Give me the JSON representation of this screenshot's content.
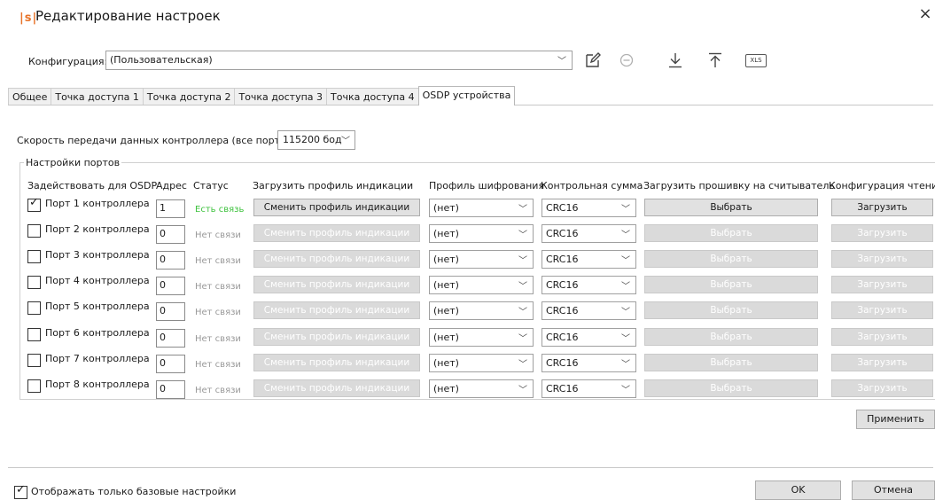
{
  "window": {
    "logo": "|s|",
    "title": "Редактирование настроек",
    "close": "×"
  },
  "config": {
    "label": "Конфигурация:",
    "value": "(Пользовательская)",
    "toolbar": {
      "edit_icon": "edit-icon",
      "remove_icon": "minus-circle-icon",
      "download_icon": "download-icon",
      "upload_icon": "upload-icon",
      "xls_label": "XLS"
    }
  },
  "tabs": [
    {
      "label": "Общее",
      "active": false
    },
    {
      "label": "Точка доступа 1",
      "active": false
    },
    {
      "label": "Точка доступа 2",
      "active": false
    },
    {
      "label": "Точка доступа 3",
      "active": false
    },
    {
      "label": "Точка доступа 4",
      "active": false
    },
    {
      "label": "OSDP устройства",
      "active": true
    }
  ],
  "speed": {
    "label": "Скорость передачи данных контроллера (все порты):",
    "value": "115200 бод"
  },
  "ports_group": {
    "legend": "Настройки портов",
    "headers": {
      "enable": "Задействовать для OSDP",
      "address": "Адрес",
      "status": "Статус",
      "indication": "Загрузить профиль индикации",
      "encryption": "Профиль шифрования",
      "checksum": "Контрольная сумма",
      "firmware": "Загрузить прошивку на считыватель",
      "read_config": "Конфигурация чтения"
    },
    "rows": [
      {
        "checked": true,
        "port": "Порт 1 контроллера",
        "address": "1",
        "status": "Есть связь",
        "connected": true,
        "indication": "Сменить профиль индикации",
        "encryption": "(нет)",
        "checksum": "CRC16",
        "firmware": "Выбрать",
        "read_config": "Загрузить"
      },
      {
        "checked": false,
        "port": "Порт 2 контроллера",
        "address": "0",
        "status": "Нет связи",
        "connected": false,
        "indication": "Сменить профиль индикации",
        "encryption": "(нет)",
        "checksum": "CRC16",
        "firmware": "Выбрать",
        "read_config": "Загрузить"
      },
      {
        "checked": false,
        "port": "Порт 3 контроллера",
        "address": "0",
        "status": "Нет связи",
        "connected": false,
        "indication": "Сменить профиль индикации",
        "encryption": "(нет)",
        "checksum": "CRC16",
        "firmware": "Выбрать",
        "read_config": "Загрузить"
      },
      {
        "checked": false,
        "port": "Порт 4 контроллера",
        "address": "0",
        "status": "Нет связи",
        "connected": false,
        "indication": "Сменить профиль индикации",
        "encryption": "(нет)",
        "checksum": "CRC16",
        "firmware": "Выбрать",
        "read_config": "Загрузить"
      },
      {
        "checked": false,
        "port": "Порт 5 контроллера",
        "address": "0",
        "status": "Нет связи",
        "connected": false,
        "indication": "Сменить профиль индикации",
        "encryption": "(нет)",
        "checksum": "CRC16",
        "firmware": "Выбрать",
        "read_config": "Загрузить"
      },
      {
        "checked": false,
        "port": "Порт 6 контроллера",
        "address": "0",
        "status": "Нет связи",
        "connected": false,
        "indication": "Сменить профиль индикации",
        "encryption": "(нет)",
        "checksum": "CRC16",
        "firmware": "Выбрать",
        "read_config": "Загрузить"
      },
      {
        "checked": false,
        "port": "Порт 7 контроллера",
        "address": "0",
        "status": "Нет связи",
        "connected": false,
        "indication": "Сменить профиль индикации",
        "encryption": "(нет)",
        "checksum": "CRC16",
        "firmware": "Выбрать",
        "read_config": "Загрузить"
      },
      {
        "checked": false,
        "port": "Порт 8 контроллера",
        "address": "0",
        "status": "Нет связи",
        "connected": false,
        "indication": "Сменить профиль индикации",
        "encryption": "(нет)",
        "checksum": "CRC16",
        "firmware": "Выбрать",
        "read_config": "Загрузить"
      }
    ]
  },
  "apply_label": "Применить",
  "footer": {
    "basic_only_checked": true,
    "basic_only_label": "Отображать только базовые настройки",
    "ok_label": "OK",
    "cancel_label": "Отмена"
  },
  "colors": {
    "logo": "#e8742a",
    "status_ok": "#3ec23e",
    "status_off": "#9a9a9a",
    "disabled_button": "#dadada"
  }
}
